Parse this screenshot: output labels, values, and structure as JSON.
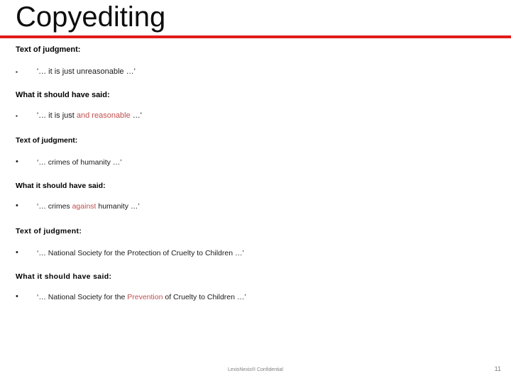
{
  "slide": {
    "title": "Copyediting",
    "accent_rule_color": "#E01B1B",
    "highlight_color": "#C0504D"
  },
  "blocks": [
    {
      "judgment_heading": "Text of judgment:",
      "judgment_bullet_mark": "▪",
      "judgment_text_before": "'… it is just unreasonable …'",
      "judgment_text_highlight": "",
      "judgment_text_after": "",
      "correction_heading": "What it should have said:",
      "correction_bullet_mark": "▪",
      "correction_text_before": "'… it is just ",
      "correction_text_highlight": "and reasonable",
      "correction_text_after": " …'"
    },
    {
      "judgment_heading": "Text of judgment:",
      "judgment_bullet_mark": "•",
      "judgment_text_before": "‘… crimes of humanity …’",
      "judgment_text_highlight": "",
      "judgment_text_after": "",
      "correction_heading": "What it should have said:",
      "correction_bullet_mark": "•",
      "correction_text_before": "‘… crimes ",
      "correction_text_highlight": "against",
      "correction_text_after": " humanity …’"
    },
    {
      "judgment_heading": "Text of judgment:",
      "judgment_bullet_mark": "•",
      "judgment_text_before": "‘… National Society for the Protection of Cruelty to Children …’",
      "judgment_text_highlight": "",
      "judgment_text_after": "",
      "correction_heading": "What it should have said:",
      "correction_bullet_mark": "•",
      "correction_text_before": "‘… National Society for the ",
      "correction_text_highlight": "Prevention",
      "correction_text_after": " of Cruelty to Children …’"
    }
  ],
  "footer": {
    "confidential_note": "LexisNexis® Confidential",
    "page_number": "11"
  }
}
